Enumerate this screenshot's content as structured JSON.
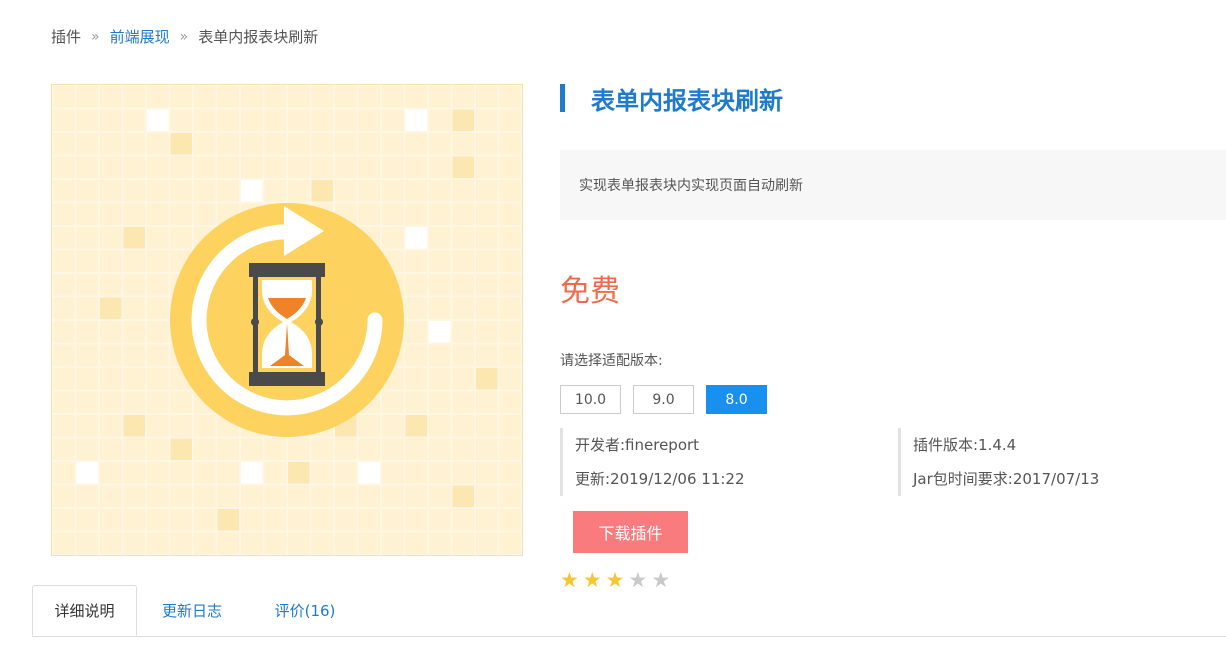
{
  "breadcrumb": {
    "root": "插件",
    "category": "前端展现",
    "current": "表单内报表块刷新",
    "separator": "»"
  },
  "plugin": {
    "title": "表单内报表块刷新",
    "description": "实现表单报表块内实现页面自动刷新",
    "price": "免费",
    "version_label": "请选择适配版本:",
    "versions": [
      "10.0",
      "9.0",
      "8.0"
    ],
    "selected_version": "8.0",
    "developer": "开发者:finereport",
    "updated": "更新:2019/12/06 11:22",
    "plugin_version": "插件版本:1.4.4",
    "jar_requirement": "Jar包时间要求:2017/07/13",
    "download_label": "下载插件",
    "rating": 3,
    "rating_max": 5,
    "icon": "hourglass-refresh-icon"
  },
  "tabs": [
    {
      "label": "详细说明"
    },
    {
      "label": "更新日志"
    },
    {
      "label": "评价(16)"
    }
  ],
  "active_tab": "详细说明",
  "colors": {
    "accent": "#1f7ac9",
    "price": "#f06b4d",
    "download": "#fa7b7e",
    "selected_version": "#1890f0",
    "star": "#f8c630",
    "icon_circle": "#fdd25f"
  }
}
